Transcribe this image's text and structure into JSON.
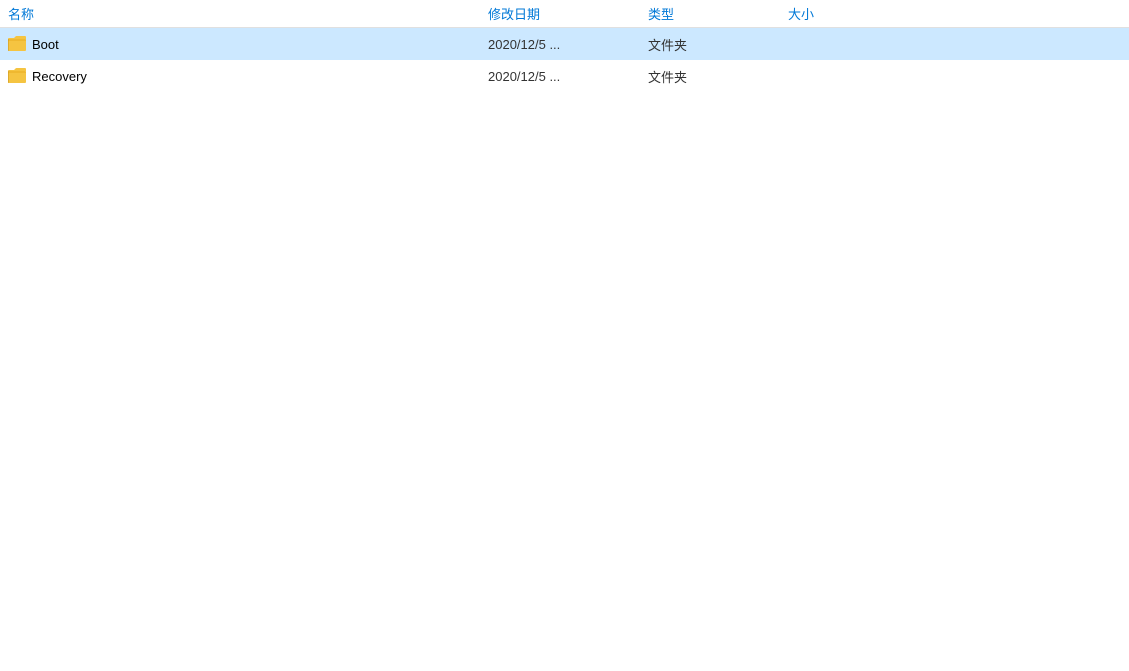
{
  "header": {
    "columns": [
      {
        "key": "name",
        "label": "名称"
      },
      {
        "key": "date",
        "label": "修改日期"
      },
      {
        "key": "type",
        "label": "类型"
      },
      {
        "key": "size",
        "label": "大小"
      }
    ]
  },
  "files": [
    {
      "name": "Boot",
      "date": "2020/12/5 ...",
      "type": "文件夹",
      "size": "",
      "selected": true
    },
    {
      "name": "Recovery",
      "date": "2020/12/5 ...",
      "type": "文件夹",
      "size": "",
      "selected": false
    }
  ],
  "colors": {
    "header_text": "#0078d7",
    "selected_bg": "#cce8ff",
    "hover_bg": "#e5f3ff",
    "folder_body": "#f5c441",
    "folder_tab": "#e6a817",
    "folder_dark": "#c8921a"
  }
}
